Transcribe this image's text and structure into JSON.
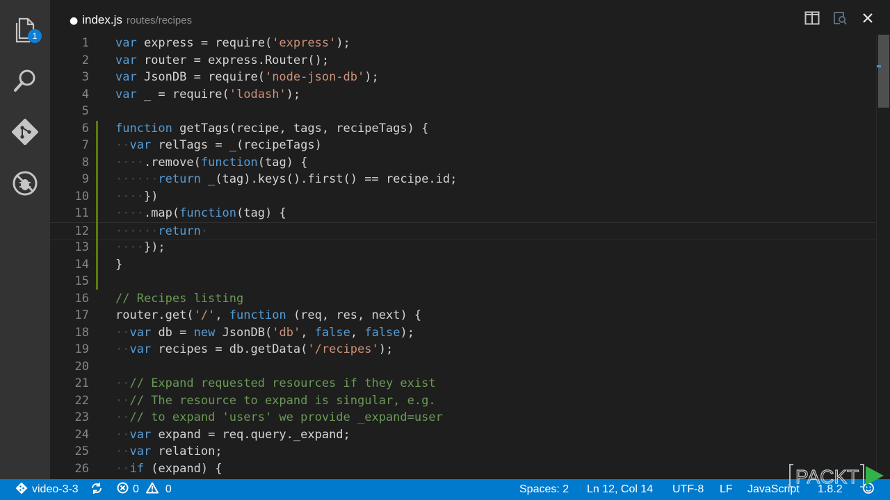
{
  "activity_bar": {
    "explorer_badge": "1",
    "icons": [
      "files-icon",
      "search-icon",
      "git-icon",
      "debug-icon"
    ]
  },
  "tab": {
    "dot": "●",
    "file_name": "index.js",
    "file_path": "routes/recipes"
  },
  "title_actions": [
    "split-editor-icon",
    "open-preview-icon",
    "close-icon"
  ],
  "editor": {
    "current_line": 12,
    "modified_lines": [
      6,
      15
    ],
    "lines": [
      {
        "n": "1",
        "t": [
          [
            "kw",
            "var"
          ],
          [
            "",
            " express = require("
          ],
          [
            "str",
            "'express'"
          ],
          [
            "",
            ");"
          ]
        ]
      },
      {
        "n": "2",
        "t": [
          [
            "kw",
            "var"
          ],
          [
            "",
            " router = express.Router();"
          ]
        ]
      },
      {
        "n": "3",
        "t": [
          [
            "kw",
            "var"
          ],
          [
            "",
            " JsonDB = require("
          ],
          [
            "str",
            "'node-json-db'"
          ],
          [
            "",
            ");"
          ]
        ]
      },
      {
        "n": "4",
        "t": [
          [
            "kw",
            "var"
          ],
          [
            "",
            " _ = require("
          ],
          [
            "str",
            "'lodash'"
          ],
          [
            "",
            ");"
          ]
        ]
      },
      {
        "n": "5",
        "t": []
      },
      {
        "n": "6",
        "t": [
          [
            "kw",
            "function"
          ],
          [
            "",
            " getTags(recipe, tags, recipeTags) {"
          ]
        ]
      },
      {
        "n": "7",
        "t": [
          [
            "ws",
            "··"
          ],
          [
            "kw",
            "var"
          ],
          [
            "",
            " relTags = _(recipeTags)"
          ]
        ]
      },
      {
        "n": "8",
        "t": [
          [
            "ws",
            "····"
          ],
          [
            "",
            ".remove("
          ],
          [
            "kw",
            "function"
          ],
          [
            "",
            "(tag) {"
          ]
        ]
      },
      {
        "n": "9",
        "t": [
          [
            "ws",
            "······"
          ],
          [
            "kw",
            "return"
          ],
          [
            "",
            " _(tag).keys().first() == recipe.id;"
          ]
        ]
      },
      {
        "n": "10",
        "t": [
          [
            "ws",
            "····"
          ],
          [
            "",
            "})"
          ]
        ]
      },
      {
        "n": "11",
        "t": [
          [
            "ws",
            "····"
          ],
          [
            "",
            ".map("
          ],
          [
            "kw",
            "function"
          ],
          [
            "",
            "(tag) {"
          ]
        ]
      },
      {
        "n": "12",
        "t": [
          [
            "ws",
            "······"
          ],
          [
            "kw",
            "return"
          ],
          [
            "ws",
            "·"
          ]
        ]
      },
      {
        "n": "13",
        "t": [
          [
            "ws",
            "····"
          ],
          [
            "",
            "});"
          ]
        ]
      },
      {
        "n": "14",
        "t": [
          [
            "",
            "}"
          ]
        ]
      },
      {
        "n": "15",
        "t": []
      },
      {
        "n": "16",
        "t": [
          [
            "cm",
            "// Recipes listing"
          ]
        ]
      },
      {
        "n": "17",
        "t": [
          [
            "",
            "router.get("
          ],
          [
            "str",
            "'/'"
          ],
          [
            "",
            ", "
          ],
          [
            "kw",
            "function"
          ],
          [
            "",
            " (req, res, next) {"
          ]
        ]
      },
      {
        "n": "18",
        "t": [
          [
            "ws",
            "··"
          ],
          [
            "kw",
            "var"
          ],
          [
            "",
            " db = "
          ],
          [
            "kw",
            "new"
          ],
          [
            "",
            " JsonDB("
          ],
          [
            "str",
            "'db'"
          ],
          [
            "",
            ", "
          ],
          [
            "kw",
            "false"
          ],
          [
            "",
            ", "
          ],
          [
            "kw",
            "false"
          ],
          [
            "",
            ");"
          ]
        ]
      },
      {
        "n": "19",
        "t": [
          [
            "ws",
            "··"
          ],
          [
            "kw",
            "var"
          ],
          [
            "",
            " recipes = db.getData("
          ],
          [
            "str",
            "'/recipes'"
          ],
          [
            "",
            ");"
          ]
        ]
      },
      {
        "n": "20",
        "t": []
      },
      {
        "n": "21",
        "t": [
          [
            "ws",
            "··"
          ],
          [
            "cm",
            "// Expand requested resources if they exist"
          ]
        ]
      },
      {
        "n": "22",
        "t": [
          [
            "ws",
            "··"
          ],
          [
            "cm",
            "// The resource to expand is singular, e.g."
          ]
        ]
      },
      {
        "n": "23",
        "t": [
          [
            "ws",
            "··"
          ],
          [
            "cm",
            "// to expand 'users' we provide _expand=user"
          ]
        ]
      },
      {
        "n": "24",
        "t": [
          [
            "ws",
            "··"
          ],
          [
            "kw",
            "var"
          ],
          [
            "",
            " expand = req.query._expand;"
          ]
        ]
      },
      {
        "n": "25",
        "t": [
          [
            "ws",
            "··"
          ],
          [
            "kw",
            "var"
          ],
          [
            "",
            " relation;"
          ]
        ]
      },
      {
        "n": "26",
        "t": [
          [
            "ws",
            "··"
          ],
          [
            "kw",
            "if"
          ],
          [
            "",
            " (expand) {"
          ]
        ]
      }
    ]
  },
  "status_bar": {
    "branch": "video-3-3",
    "errors": "0",
    "warnings": "0",
    "spaces": "Spaces: 2",
    "position": "Ln 12, Col 14",
    "encoding": "UTF-8",
    "eol": "LF",
    "language": "JavaScript",
    "version": "1.8.2"
  },
  "watermark": "PACKT",
  "colors": {
    "accent": "#007acc",
    "keyword": "#569cd6",
    "string": "#ce9178",
    "comment": "#6a9955",
    "modified_gutter": "#587c0c"
  }
}
